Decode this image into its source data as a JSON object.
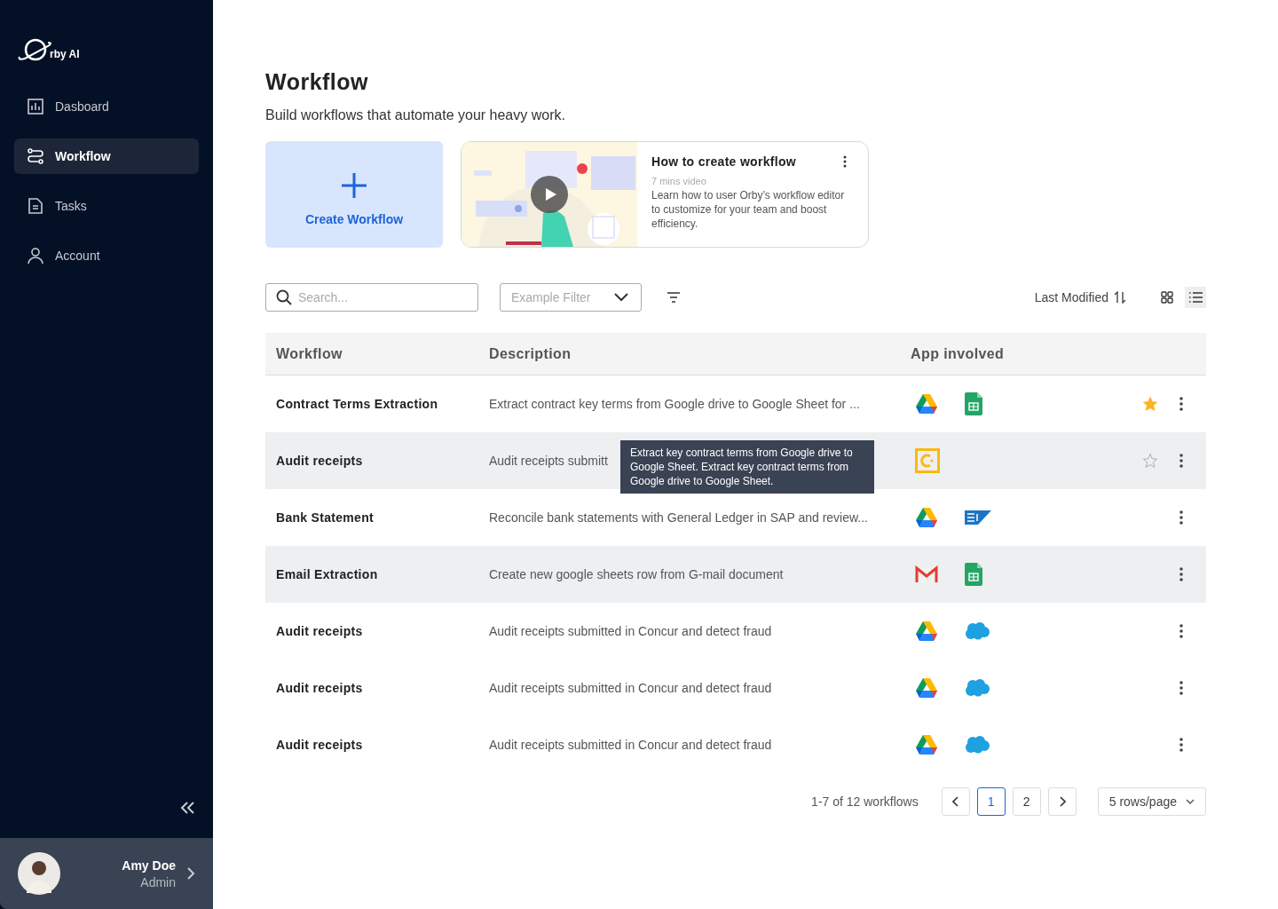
{
  "sidebar": {
    "logo": "rby AI",
    "items": [
      {
        "label": "Dasboard",
        "selected": false
      },
      {
        "label": "Workflow",
        "selected": true
      },
      {
        "label": "Tasks",
        "selected": false
      },
      {
        "label": "Account",
        "selected": false
      }
    ],
    "user": {
      "name": "Amy Doe",
      "role": "Admin"
    }
  },
  "page": {
    "title": "Workflow",
    "subtitle": "Build workflows that automate your heavy work."
  },
  "create_card": {
    "label": "Create Workflow"
  },
  "video_card": {
    "title": "How to create workflow",
    "meta": "7 mins video",
    "description": "Learn how to user Orby’s workflow editor to customize for your team and boost efficiency."
  },
  "toolbar": {
    "search": {
      "placeholder": "Search..."
    },
    "filter": {
      "placeholder": "Example Filter"
    },
    "sort": {
      "label": "Last Modified"
    },
    "views": [
      {
        "kind": "grid",
        "selected": false
      },
      {
        "kind": "list",
        "selected": true
      }
    ]
  },
  "table": {
    "columns": [
      "Workflow",
      "Description",
      "App involved"
    ],
    "rows": [
      {
        "name": "Contract Terms Extraction",
        "description": "Extract contract key terms from Google drive to Google Sheet for ...",
        "apps": [
          {
            "kind": "drive"
          },
          {
            "kind": "sheets"
          }
        ],
        "starred": true,
        "highlighted": false
      },
      {
        "name": "Audit receipts",
        "description": "Audit receipts submitt",
        "apps": [
          {
            "kind": "concur"
          }
        ],
        "starred": false,
        "highlighted": true,
        "tooltip": "Extract key contract terms from Google drive to Google Sheet. Extract key contract terms from Google drive to Google Sheet."
      },
      {
        "name": "Bank Statement",
        "description": "Reconcile bank statements with General Ledger in SAP and review...",
        "apps": [
          {
            "kind": "drive"
          },
          {
            "kind": "sap"
          }
        ],
        "highlighted": false
      },
      {
        "name": "Email Extraction",
        "description": "Create new google sheets row from G-mail document",
        "apps": [
          {
            "kind": "gmail"
          },
          {
            "kind": "sheets"
          }
        ],
        "highlighted": true
      },
      {
        "name": "Audit receipts",
        "description": "Audit receipts submitted in Concur and detect fraud",
        "apps": [
          {
            "kind": "drive"
          },
          {
            "kind": "salesforce"
          }
        ],
        "highlighted": false
      },
      {
        "name": "Audit receipts",
        "description": "Audit receipts submitted in Concur and detect fraud",
        "apps": [
          {
            "kind": "drive"
          },
          {
            "kind": "salesforce"
          }
        ],
        "highlighted": false
      },
      {
        "name": "Audit receipts",
        "description": "Audit receipts submitted in Concur and detect fraud",
        "apps": [
          {
            "kind": "drive"
          },
          {
            "kind": "salesforce"
          }
        ],
        "highlighted": false
      }
    ]
  },
  "pagination": {
    "summary": "1-7 of 12 workflows",
    "pages": [
      {
        "label": "1",
        "selected": true
      },
      {
        "label": "2",
        "selected": false
      }
    ],
    "page_size": "5 rows/page"
  }
}
